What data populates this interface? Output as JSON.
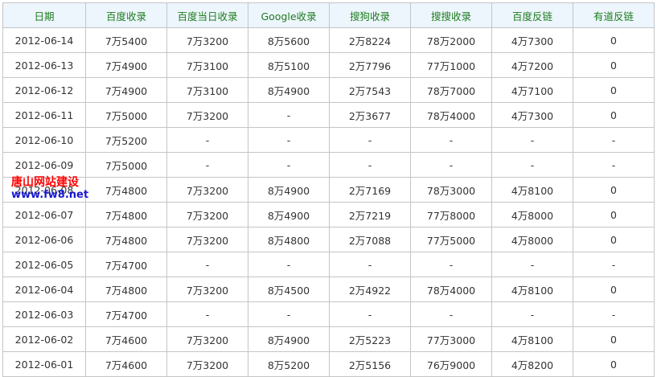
{
  "table": {
    "headers": [
      "日期",
      "百度收录",
      "百度当日收录",
      "Google收录",
      "搜狗收录",
      "搜搜收录",
      "百度反链",
      "有道反链"
    ],
    "rows": [
      [
        "2012-06-14",
        "7万5400",
        "7万3200",
        "8万5600",
        "2万8224",
        "78万2000",
        "4万7300",
        "0"
      ],
      [
        "2012-06-13",
        "7万4900",
        "7万3100",
        "8万5100",
        "2万7796",
        "77万1000",
        "4万7200",
        "0"
      ],
      [
        "2012-06-12",
        "7万4900",
        "7万3100",
        "8万4900",
        "2万7543",
        "78万7000",
        "4万7100",
        "0"
      ],
      [
        "2012-06-11",
        "7万5000",
        "7万3200",
        "-",
        "2万3677",
        "78万4000",
        "4万7300",
        "0"
      ],
      [
        "2012-06-10",
        "7万5200",
        "-",
        "-",
        "-",
        "-",
        "-",
        "-"
      ],
      [
        "2012-06-09",
        "7万5000",
        "-",
        "-",
        "-",
        "-",
        "-",
        "-"
      ],
      [
        "2012-06-08",
        "7万4800",
        "7万3200",
        "8万4900",
        "2万7169",
        "78万3000",
        "4万8100",
        "0"
      ],
      [
        "2012-06-07",
        "7万4800",
        "7万3200",
        "8万4900",
        "2万7219",
        "77万8000",
        "4万8000",
        "0"
      ],
      [
        "2012-06-06",
        "7万4800",
        "7万3200",
        "8万4800",
        "2万7088",
        "77万5000",
        "4万8000",
        "0"
      ],
      [
        "2012-06-05",
        "7万4700",
        "-",
        "-",
        "-",
        "-",
        "-",
        "-"
      ],
      [
        "2012-06-04",
        "7万4800",
        "7万3200",
        "8万4500",
        "2万4922",
        "78万4000",
        "4万8100",
        "0"
      ],
      [
        "2012-06-03",
        "7万4700",
        "-",
        "-",
        "-",
        "-",
        "-",
        "-"
      ],
      [
        "2012-06-02",
        "7万4600",
        "7万3200",
        "8万4900",
        "2万5223",
        "77万3000",
        "4万8100",
        "0"
      ],
      [
        "2012-06-01",
        "7万4600",
        "7万3200",
        "8万5200",
        "2万5156",
        "76万9000",
        "4万8200",
        "0"
      ]
    ]
  },
  "watermark": {
    "line1": "唐山网站建设",
    "line2": "www.fw8.net",
    "colors": {
      "line1": "#ff0000",
      "line2": "#1a1ad0"
    }
  },
  "colors": {
    "header_text": "#1e7d1e",
    "header_bg": "#edf5fd",
    "border": "#c5c5c5",
    "cell_text": "#333333"
  }
}
